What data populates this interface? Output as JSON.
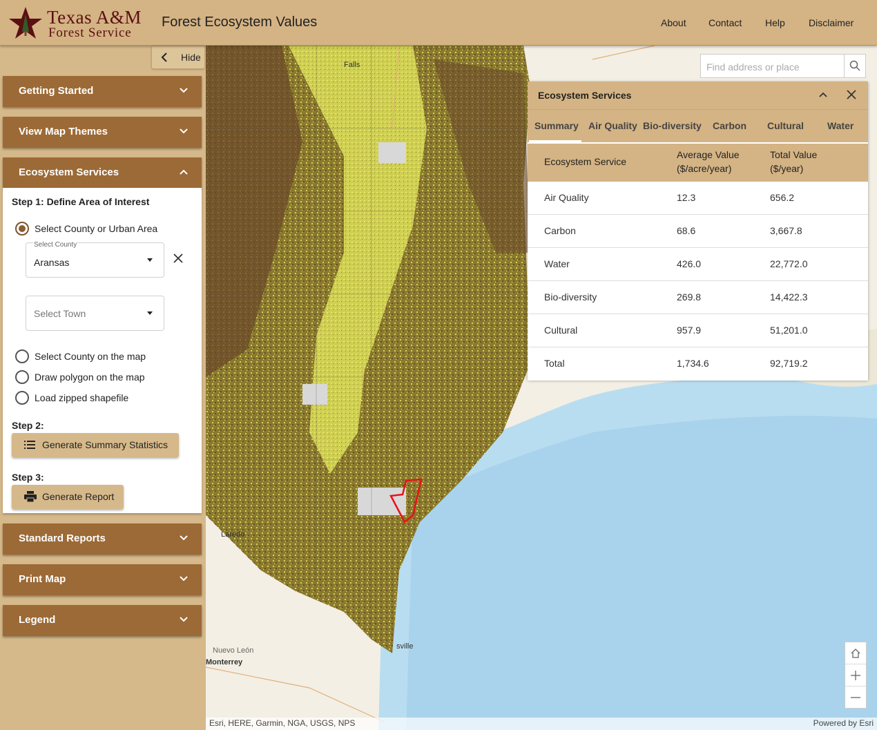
{
  "header": {
    "logo_line1": "Texas A&M",
    "logo_line2": "Forest Service",
    "title": "Forest Ecosystem Values",
    "nav": [
      "About",
      "Contact",
      "Help",
      "Disclaimer"
    ]
  },
  "sidebar": {
    "hide_label": "Hide",
    "sections": [
      "Getting Started",
      "View Map Themes",
      "Ecosystem Services",
      "Standard Reports",
      "Print Map",
      "Legend"
    ],
    "ecosystem": {
      "step1": "Step 1: Define Area of Interest",
      "options": [
        "Select County or Urban Area",
        "Select County on the map",
        "Draw polygon on the map",
        "Load zipped shapefile"
      ],
      "selected_option": 0,
      "county_label": "Select County",
      "county_value": "Aransas",
      "town_placeholder": "Select Town",
      "step2": "Step 2:",
      "summary_button": "Generate Summary Statistics",
      "step3": "Step 3:",
      "report_button": "Generate Report"
    }
  },
  "map": {
    "search_placeholder": "Find address or place",
    "labels": [
      "Falls",
      "Laredo",
      "Nuevo León",
      "Monterrey",
      "sville"
    ],
    "attribution_left": "Esri, HERE, Garmin, NGA, USGS, NPS",
    "attribution_right": "Powered by Esri",
    "colors": {
      "forest_dark": "#6b4a2b",
      "forest_light": "#d9d25a",
      "water": "#b9ddf0",
      "selection": "#e8111b"
    }
  },
  "eco_panel": {
    "title": "Ecosystem Services",
    "tabs": [
      "Summary",
      "Air Quality",
      "Bio-diversity",
      "Carbon",
      "Cultural",
      "Water"
    ],
    "active_tab": "Summary",
    "columns": [
      "Ecosystem Service",
      "Average Value",
      "($/acre/year)",
      "Total Value",
      "($/year)"
    ],
    "rows": [
      [
        "Air Quality",
        "12.3",
        "656.2"
      ],
      [
        "Carbon",
        "68.6",
        "3,667.8"
      ],
      [
        "Water",
        "426.0",
        "22,772.0"
      ],
      [
        "Bio-diversity",
        "269.8",
        "14,422.3"
      ],
      [
        "Cultural",
        "957.9",
        "51,201.0"
      ],
      [
        "Total",
        "1,734.6",
        "92,719.2"
      ]
    ]
  },
  "theme": {
    "header_bg": "#d4b384",
    "accordion_bg": "#9c6a36",
    "panel_bg": "#d6b98a"
  }
}
